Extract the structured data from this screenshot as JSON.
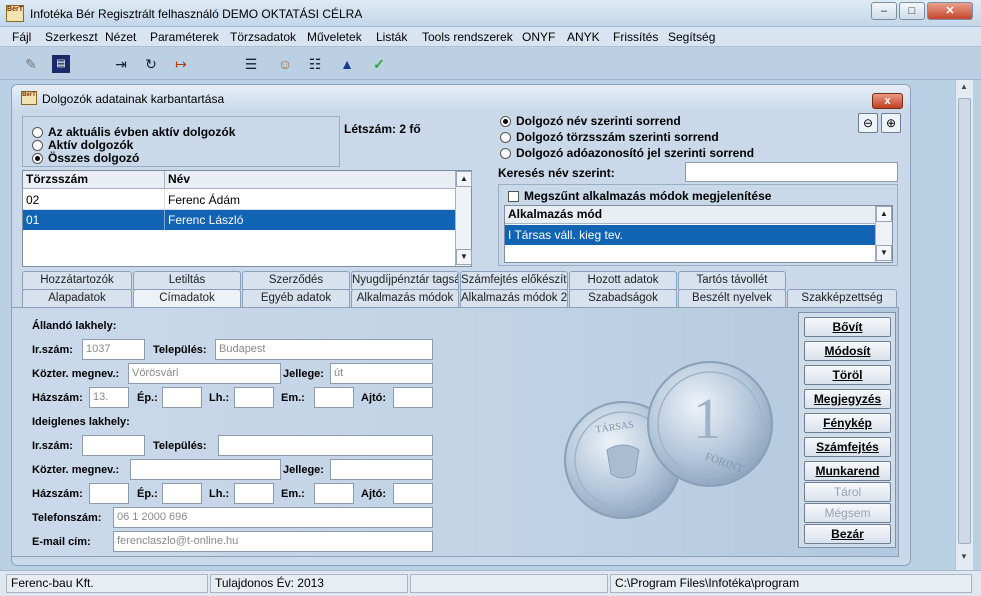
{
  "app": {
    "title": "Infotéka Bér Regisztrált felhasználó DEMO OKTATÁSI CÉLRA",
    "logo": "BérT",
    "colors": {
      "accent": "#1164b4"
    }
  },
  "menu": [
    "Fájl",
    "Szerkeszt",
    "Nézet",
    "Paraméterek",
    "Törzsadatok",
    "Műveletek",
    "Listák",
    "Tools rendszerek",
    "ONYF",
    "ANYK",
    "Frissítés",
    "Segítség"
  ],
  "toolbar": [
    "edit-icon",
    "save-icon",
    "export-icon",
    "refresh-icon",
    "exit-icon",
    "list-icon",
    "person-icon",
    "document-icon",
    "navigation-icon",
    "checkmark-icon"
  ],
  "child": {
    "title": "Dolgozók adatainak karbantartása",
    "close": "x"
  },
  "filter": {
    "options": [
      "Az aktuális évben aktív dolgozók",
      "Aktív dolgozók",
      "Összes dolgozó"
    ],
    "selected": 2
  },
  "count": {
    "text": "Létszám: 2 fő"
  },
  "sort": {
    "options": [
      "Dolgozó név szerinti sorrend",
      "Dolgozó törzsszám szerinti sorrend",
      "Dolgozó adóazonosító jel szerinti sorrend"
    ],
    "selected": 0
  },
  "search": {
    "label": "Keresés név szerint:",
    "value": ""
  },
  "employees": {
    "headers": [
      "Törzsszám",
      "Név"
    ],
    "rows": [
      [
        "02",
        "Ferenc Ádám"
      ],
      [
        "01",
        "Ferenc László"
      ]
    ],
    "selected": 1
  },
  "modes": {
    "checkbox": "Megszűnt alkalmazás módok megjelenítése",
    "header": "Alkalmazás mód",
    "rows": [
      "I Társas váll. kieg tev."
    ]
  },
  "tabs_top": [
    "Hozzátartozók",
    "Letiltás",
    "Szerződés",
    "Nyugdíjpénztár tagság",
    "Számfejtés előkészítés",
    "Hozott adatok",
    "Tartós távollét"
  ],
  "tabs_bottom": [
    "Alapadatok",
    "Címadatok",
    "Egyéb adatok",
    "Alkalmazás módok",
    "Alkalmazás módok 2.",
    "Szabadságok",
    "Beszélt nyelvek",
    "Szakképzettség"
  ],
  "active_tab": "Címadatok",
  "address": {
    "permanent_title": "Állandó lakhely:",
    "temporary_title": "Ideiglenes lakhely:",
    "labels": {
      "zip": "Ir.szám:",
      "city": "Település:",
      "street": "Közter. megnev.:",
      "type": "Jellege:",
      "house": "Házszám:",
      "bldg": "Ép.:",
      "stair": "Lh.:",
      "floor": "Em.:",
      "door": "Ajtó:",
      "phone": "Telefonszám:",
      "email": "E-mail cím:"
    },
    "permanent": {
      "zip": "1037",
      "city": "Budapest",
      "street": "Vörösvári",
      "type": "út",
      "house": "13.",
      "bldg": "",
      "stair": "",
      "floor": "",
      "door": ""
    },
    "temporary": {
      "zip": "",
      "city": "",
      "street": "",
      "type": "",
      "house": "",
      "bldg": "",
      "stair": "",
      "floor": "",
      "door": ""
    },
    "phone": "06 1 2000 696",
    "email": "ferenclaszlo@t-online.hu"
  },
  "coin": {
    "text1": "TÁRSAS",
    "text2": "FORINT",
    "numeral": "1"
  },
  "actions": [
    {
      "label": "Bővít",
      "enabled": true
    },
    {
      "label": "Módosít",
      "enabled": true
    },
    {
      "label": "Töröl",
      "enabled": true
    },
    {
      "label": "Megjegyzés",
      "enabled": true
    },
    {
      "label": "Fénykép",
      "enabled": true
    },
    {
      "label": "Számfejtés",
      "enabled": true
    },
    {
      "label": "Munkarend",
      "enabled": true
    },
    {
      "label": "Tárol",
      "enabled": false
    },
    {
      "label": "Mégsem",
      "enabled": false
    },
    {
      "label": "Bezár",
      "enabled": true
    }
  ],
  "status": [
    "Ferenc-bau Kft.",
    "Tulajdonos Év: 2013",
    "",
    "C:\\Program Files\\Infotéka\\program"
  ]
}
